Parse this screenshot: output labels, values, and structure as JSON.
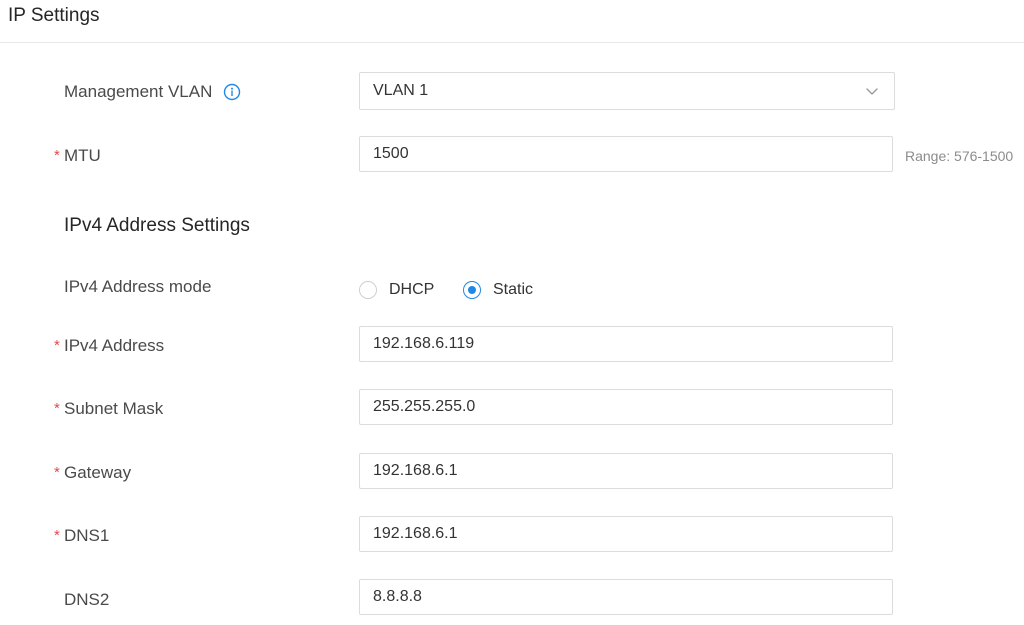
{
  "section": {
    "title": "IP Settings"
  },
  "fields": {
    "management_vlan": {
      "label": "Management VLAN",
      "value": "VLAN 1",
      "info_icon": "info-icon"
    },
    "mtu": {
      "label": "MTU",
      "required": "*",
      "value": "1500",
      "hint": "Range: 576-1500"
    }
  },
  "ipv4": {
    "title": "IPv4 Address Settings",
    "mode": {
      "label": "IPv4 Address mode",
      "options": [
        {
          "label": "DHCP",
          "checked": false
        },
        {
          "label": "Static",
          "checked": true
        }
      ]
    },
    "address": {
      "label": "IPv4 Address",
      "required": "*",
      "value": "192.168.6.119"
    },
    "subnet": {
      "label": "Subnet Mask",
      "required": "*",
      "value": "255.255.255.0"
    },
    "gateway": {
      "label": "Gateway",
      "required": "*",
      "value": "192.168.6.1"
    },
    "dns1": {
      "label": "DNS1",
      "required": "*",
      "value": "192.168.6.1"
    },
    "dns2": {
      "label": "DNS2",
      "value": "8.8.8.8"
    }
  },
  "colors": {
    "accent": "#1f8ae6",
    "required": "#e5484d",
    "border": "#dcdcdc",
    "hint": "#8c8c8c"
  }
}
